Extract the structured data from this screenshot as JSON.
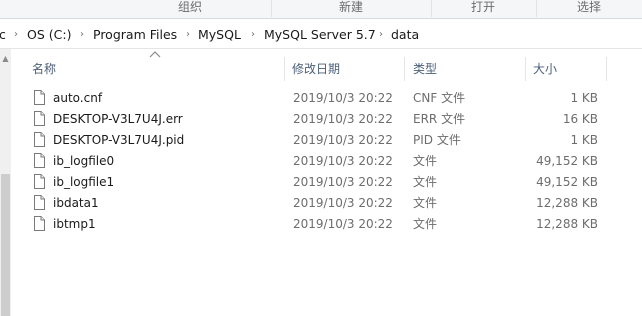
{
  "ribbon": {
    "groups": [
      "组织",
      "新建",
      "打开",
      "选择"
    ]
  },
  "address": {
    "crumbs": [
      "c",
      "OS (C:)",
      "Program Files",
      "MySQL",
      "MySQL Server 5.7",
      "data"
    ]
  },
  "columns": {
    "name": "名称",
    "date": "修改日期",
    "type": "类型",
    "size": "大小"
  },
  "files": [
    {
      "name": "auto.cnf",
      "date": "2019/10/3 20:22",
      "type": "CNF 文件",
      "size": "1 KB"
    },
    {
      "name": "DESKTOP-V3L7U4J.err",
      "date": "2019/10/3 20:22",
      "type": "ERR 文件",
      "size": "16 KB"
    },
    {
      "name": "DESKTOP-V3L7U4J.pid",
      "date": "2019/10/3 20:22",
      "type": "PID 文件",
      "size": "1 KB"
    },
    {
      "name": "ib_logfile0",
      "date": "2019/10/3 20:22",
      "type": "文件",
      "size": "49,152 KB"
    },
    {
      "name": "ib_logfile1",
      "date": "2019/10/3 20:22",
      "type": "文件",
      "size": "49,152 KB"
    },
    {
      "name": "ibdata1",
      "date": "2019/10/3 20:22",
      "type": "文件",
      "size": "12,288 KB"
    },
    {
      "name": "ibtmp1",
      "date": "2019/10/3 20:22",
      "type": "文件",
      "size": "12,288 KB"
    }
  ],
  "icons": {
    "file": "file-icon",
    "chevron": "chevron-right-icon",
    "sort": "sort-ascending-icon"
  }
}
